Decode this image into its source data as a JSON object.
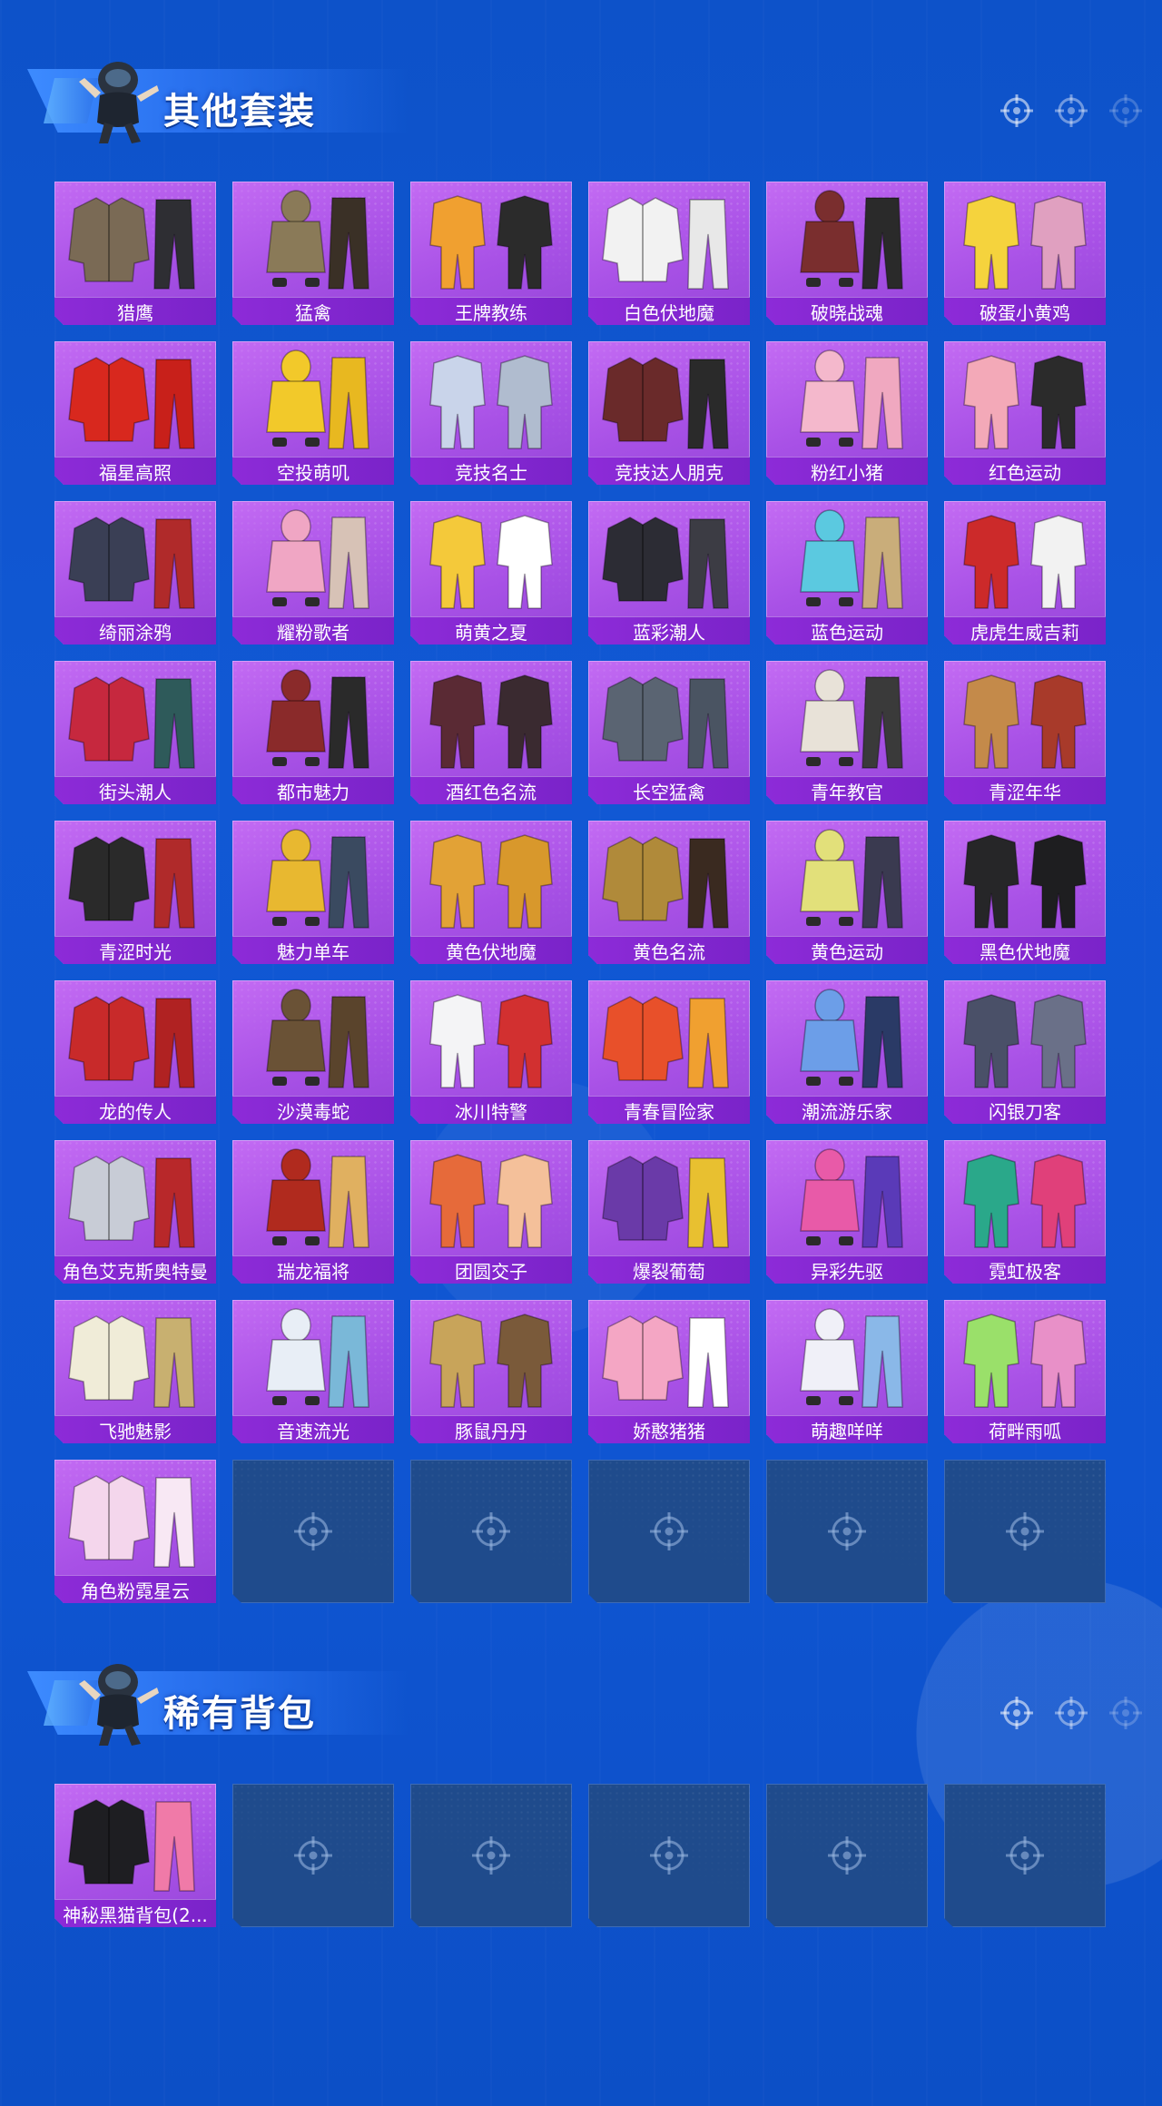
{
  "sections": [
    {
      "title": "其他套装",
      "items": [
        {
          "label": "猎鹰",
          "palette": [
            "#7a6a55",
            "#2e2e33"
          ]
        },
        {
          "label": "猛禽",
          "palette": [
            "#8a7a58",
            "#3a3026"
          ]
        },
        {
          "label": "王牌教练",
          "palette": [
            "#f0a030",
            "#2b2b2b"
          ]
        },
        {
          "label": "白色伏地魔",
          "palette": [
            "#f2f2f2",
            "#e8e8e8"
          ]
        },
        {
          "label": "破晓战魂",
          "palette": [
            "#7a2e2e",
            "#2a2a2a"
          ]
        },
        {
          "label": "破蛋小黄鸡",
          "palette": [
            "#f5d33d",
            "#e0a0c0"
          ]
        },
        {
          "label": "福星高照",
          "palette": [
            "#d8281e",
            "#c8201a"
          ]
        },
        {
          "label": "空投萌叽",
          "palette": [
            "#f2c92a",
            "#e8b820"
          ]
        },
        {
          "label": "竞技名士",
          "palette": [
            "#c9d4ea",
            "#b0bccf"
          ]
        },
        {
          "label": "竞技达人朋克",
          "palette": [
            "#6a2a2a",
            "#2a2a2a"
          ]
        },
        {
          "label": "粉红小猪",
          "palette": [
            "#f4b8cc",
            "#f0a8c0"
          ]
        },
        {
          "label": "红色运动",
          "palette": [
            "#f3a9b8",
            "#2b2b2b"
          ]
        },
        {
          "label": "绮丽涂鸦",
          "palette": [
            "#3a3f55",
            "#b02a2a"
          ]
        },
        {
          "label": "耀粉歌者",
          "palette": [
            "#f0a6c4",
            "#d7c2b6"
          ]
        },
        {
          "label": "萌黄之夏",
          "palette": [
            "#f4c93a",
            "#ffffff"
          ]
        },
        {
          "label": "蓝彩潮人",
          "palette": [
            "#2c2c34",
            "#3c3c44"
          ]
        },
        {
          "label": "蓝色运动",
          "palette": [
            "#5bc9e0",
            "#c9ad7a"
          ]
        },
        {
          "label": "虎虎生威吉莉",
          "palette": [
            "#cc2a2a",
            "#f2f2f2"
          ]
        },
        {
          "label": "街头潮人",
          "palette": [
            "#c6283e",
            "#2e5a5a"
          ]
        },
        {
          "label": "都市魅力",
          "palette": [
            "#8a2a2a",
            "#2a2a2a"
          ]
        },
        {
          "label": "酒红色名流",
          "palette": [
            "#5a2a34",
            "#3a2a30"
          ]
        },
        {
          "label": "长空猛禽",
          "palette": [
            "#5a6472",
            "#4a5462"
          ]
        },
        {
          "label": "青年教官",
          "palette": [
            "#e8e2d8",
            "#3a3a3a"
          ]
        },
        {
          "label": "青涩年华",
          "palette": [
            "#c48a4a",
            "#a83a2a"
          ]
        },
        {
          "label": "青涩时光",
          "palette": [
            "#2a2a2a",
            "#b02a2a"
          ]
        },
        {
          "label": "魅力单车",
          "palette": [
            "#e8b830",
            "#3a4a60"
          ]
        },
        {
          "label": "黄色伏地魔",
          "palette": [
            "#e2a236",
            "#d8982c"
          ]
        },
        {
          "label": "黄色名流",
          "palette": [
            "#b08a3a",
            "#3a2a20"
          ]
        },
        {
          "label": "黄色运动",
          "palette": [
            "#e2e07a",
            "#3a3a50"
          ]
        },
        {
          "label": "黑色伏地魔",
          "palette": [
            "#262628",
            "#1e1e20"
          ]
        },
        {
          "label": "龙的传人",
          "palette": [
            "#c82a2a",
            "#b02222"
          ]
        },
        {
          "label": "沙漠毒蛇",
          "palette": [
            "#6a5236",
            "#5a442c"
          ]
        },
        {
          "label": "冰川特警",
          "palette": [
            "#f4f4f6",
            "#d23030"
          ]
        },
        {
          "label": "青春冒险家",
          "palette": [
            "#e8502a",
            "#f0a030"
          ]
        },
        {
          "label": "潮流游乐家",
          "palette": [
            "#6c9ee8",
            "#2a3a66"
          ]
        },
        {
          "label": "闪银刀客",
          "palette": [
            "#4a5068",
            "#6a7088"
          ]
        },
        {
          "label": "角色艾克斯奥特曼",
          "palette": [
            "#c8ccd6",
            "#b8282a"
          ]
        },
        {
          "label": "瑞龙福将",
          "palette": [
            "#b02a1e",
            "#e0b060"
          ]
        },
        {
          "label": "团圆交子",
          "palette": [
            "#e66a3a",
            "#f4c09a"
          ]
        },
        {
          "label": "爆裂葡萄",
          "palette": [
            "#6a3aa8",
            "#e8c030"
          ]
        },
        {
          "label": "异彩先驱",
          "palette": [
            "#e85aa8",
            "#5a3ab8"
          ]
        },
        {
          "label": "霓虹极客",
          "palette": [
            "#2aa88a",
            "#e0407a"
          ]
        },
        {
          "label": "飞驰魅影",
          "palette": [
            "#f0ecd8",
            "#c8b070"
          ]
        },
        {
          "label": "音速流光",
          "palette": [
            "#e8eef6",
            "#7ab8d8"
          ]
        },
        {
          "label": "豚鼠丹丹",
          "palette": [
            "#c8a45a",
            "#7a5a3a"
          ]
        },
        {
          "label": "娇憨猪猪",
          "palette": [
            "#f4a6c4",
            "#ffffff"
          ]
        },
        {
          "label": "萌趣咩咩",
          "palette": [
            "#f0f0f8",
            "#8ab8e8"
          ]
        },
        {
          "label": "荷畔雨呱",
          "palette": [
            "#9ae06a",
            "#e890c8"
          ]
        },
        {
          "label": "角色粉霓星云",
          "palette": [
            "#f4d6ec",
            "#f8e8f4"
          ]
        }
      ],
      "empty_slots": 5
    },
    {
      "title": "稀有背包",
      "items": [
        {
          "label": "神秘黑猫背包(2...",
          "palette": [
            "#1e1e22",
            "#f07aa8"
          ]
        }
      ],
      "empty_slots": 5
    }
  ],
  "icons": {
    "header_reticle": "crosshair-icon",
    "empty_slot": "crosshair-icon",
    "mascot": "skydiver-mascot-icon"
  },
  "colors": {
    "background": "#0f55d2",
    "card_purple": "#a851e6",
    "label_bar": "#8d2bd8",
    "empty_slot": "#1f4b8c"
  }
}
